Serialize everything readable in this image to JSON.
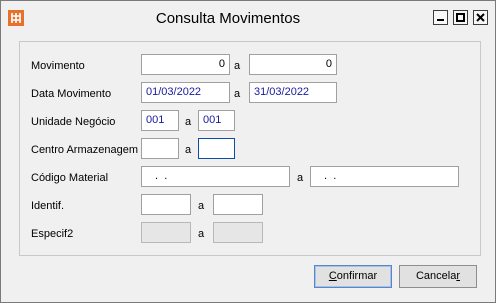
{
  "window": {
    "title": "Consulta Movimentos",
    "icon": "app-grid-icon",
    "accent": "#e8702a"
  },
  "form": {
    "movimento": {
      "label": "Movimento",
      "from": "0",
      "sep": "a",
      "to": "0"
    },
    "data_movimento": {
      "label": "Data Movimento",
      "from": "01/03/2022",
      "sep": "a",
      "to": "31/03/2022"
    },
    "unidade_negocio": {
      "label": "Unidade Negócio",
      "from": "001",
      "sep": "a",
      "to": "001"
    },
    "centro_armazenagem": {
      "label": "Centro Armazenagem",
      "from": "",
      "sep": "a",
      "to": ""
    },
    "codigo_material": {
      "label": "Código Material",
      "from": " .  .",
      "sep": "a",
      "to": " .  ."
    },
    "identif": {
      "label": "Identif.",
      "from": "",
      "sep": "a",
      "to": ""
    },
    "especif2": {
      "label": "Especif2",
      "from": "",
      "sep": "a",
      "to": ""
    }
  },
  "buttons": {
    "confirm_prefix": "C",
    "confirm_rest": "onfirmar",
    "cancel_prefix": "Cancela",
    "cancel_underlined": "r"
  }
}
